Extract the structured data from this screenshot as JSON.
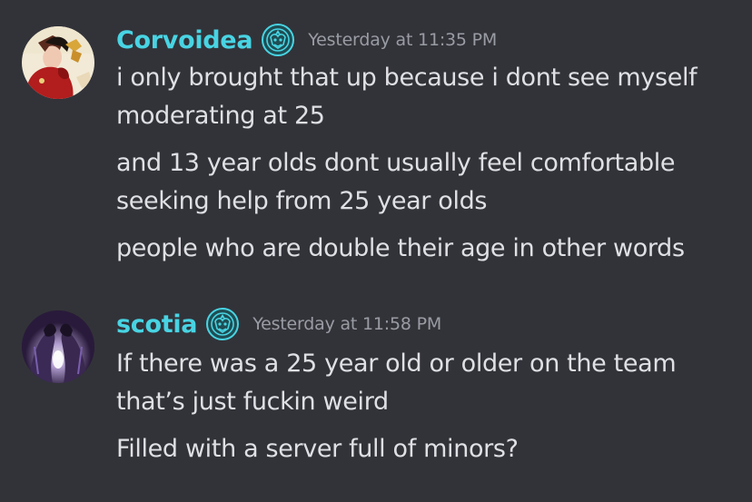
{
  "messages": [
    {
      "username": "Corvoidea",
      "timestamp": "Yesterday at 11:35 PM",
      "lines": [
        "i only brought that up because i dont see myself",
        "moderating at 25",
        "and 13 year olds dont usually feel comfortable",
        "seeking help from 25 year olds",
        "people who are double their age in other words"
      ],
      "avatar_icon": "user-avatar",
      "badge_icon": "role-badge-icon"
    },
    {
      "username": "scotia",
      "timestamp": "Yesterday at 11:58 PM",
      "lines": [
        "If there was a 25 year old or older on the team",
        "that’s just fuckin weird",
        "Filled with a server full of minors?"
      ],
      "avatar_icon": "user-avatar",
      "badge_icon": "role-badge-icon"
    }
  ],
  "colors": {
    "background": "#323339",
    "username": "#48d4e3",
    "text": "#dfe0e4",
    "timestamp": "#9a9ca4"
  }
}
